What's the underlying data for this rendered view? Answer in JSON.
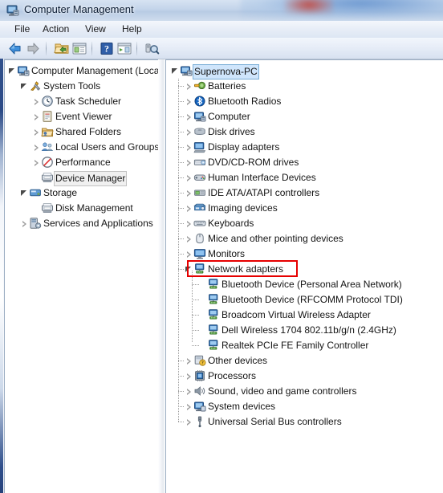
{
  "window": {
    "title": "Computer Management",
    "icon": "computer-management-icon"
  },
  "menubar": {
    "items": [
      {
        "label": "File",
        "name": "menu-file"
      },
      {
        "label": "Action",
        "name": "menu-action"
      },
      {
        "label": "View",
        "name": "menu-view"
      },
      {
        "label": "Help",
        "name": "menu-help"
      }
    ]
  },
  "toolbar": {
    "buttons": [
      {
        "name": "back-arrow-icon",
        "tip": "Back"
      },
      {
        "name": "forward-arrow-icon",
        "tip": "Forward"
      },
      {
        "name": "up-folder-icon",
        "tip": "Up One Level"
      },
      {
        "name": "show-hide-console-tree-icon",
        "tip": "Show/Hide Console Tree"
      },
      {
        "name": "help-question-icon",
        "tip": "Help"
      },
      {
        "name": "show-hide-action-pane-icon",
        "tip": "Show/Hide Action Pane"
      },
      {
        "name": "scan-hardware-changes-icon",
        "tip": "Scan for hardware changes"
      }
    ]
  },
  "left_tree": {
    "nodes": [
      {
        "label": "Computer Management (Local",
        "icon": "computer-icon",
        "indent": 0,
        "expander": "expanded",
        "state": "normal",
        "name": "tree-node-computer-management"
      },
      {
        "label": "System Tools",
        "icon": "tools-icon",
        "indent": 1,
        "expander": "expanded",
        "state": "normal",
        "name": "tree-node-system-tools"
      },
      {
        "label": "Task Scheduler",
        "icon": "clock-icon",
        "indent": 2,
        "expander": "collapsed",
        "state": "normal",
        "name": "tree-node-task-scheduler"
      },
      {
        "label": "Event Viewer",
        "icon": "event-viewer-icon",
        "indent": 2,
        "expander": "collapsed",
        "state": "normal",
        "name": "tree-node-event-viewer"
      },
      {
        "label": "Shared Folders",
        "icon": "shared-folder-icon",
        "indent": 2,
        "expander": "collapsed",
        "state": "normal",
        "name": "tree-node-shared-folders"
      },
      {
        "label": "Local Users and Groups",
        "icon": "users-group-icon",
        "indent": 2,
        "expander": "collapsed",
        "state": "normal",
        "name": "tree-node-local-users-and-groups"
      },
      {
        "label": "Performance",
        "icon": "performance-icon",
        "indent": 2,
        "expander": "collapsed",
        "state": "normal",
        "name": "tree-node-performance"
      },
      {
        "label": "Device Manager",
        "icon": "device-manager-icon",
        "indent": 2,
        "expander": "none",
        "state": "selected-inactive",
        "name": "tree-node-device-manager"
      },
      {
        "label": "Storage",
        "icon": "storage-icon",
        "indent": 1,
        "expander": "expanded",
        "state": "normal",
        "name": "tree-node-storage"
      },
      {
        "label": "Disk Management",
        "icon": "disk-management-icon",
        "indent": 2,
        "expander": "none",
        "state": "normal",
        "name": "tree-node-disk-management"
      },
      {
        "label": "Services and Applications",
        "icon": "services-icon",
        "indent": 1,
        "expander": "collapsed",
        "state": "normal",
        "name": "tree-node-services-and-applications"
      }
    ]
  },
  "right_tree": {
    "nodes": [
      {
        "label": "Supernova-PC",
        "icon": "computer-icon",
        "indent": 0,
        "expander": "expanded",
        "state": "selected-active",
        "name": "device-node-supernova-pc"
      },
      {
        "label": "Batteries",
        "icon": "battery-icon",
        "indent": 1,
        "expander": "collapsed",
        "state": "normal",
        "name": "device-node-batteries"
      },
      {
        "label": "Bluetooth Radios",
        "icon": "bluetooth-icon",
        "indent": 1,
        "expander": "collapsed",
        "state": "normal",
        "name": "device-node-bluetooth-radios"
      },
      {
        "label": "Computer",
        "icon": "computer-small-icon",
        "indent": 1,
        "expander": "collapsed",
        "state": "normal",
        "name": "device-node-computer"
      },
      {
        "label": "Disk drives",
        "icon": "disk-drive-icon",
        "indent": 1,
        "expander": "collapsed",
        "state": "normal",
        "name": "device-node-disk-drives"
      },
      {
        "label": "Display adapters",
        "icon": "display-adapter-icon",
        "indent": 1,
        "expander": "collapsed",
        "state": "normal",
        "name": "device-node-display-adapters"
      },
      {
        "label": "DVD/CD-ROM drives",
        "icon": "dvd-drive-icon",
        "indent": 1,
        "expander": "collapsed",
        "state": "normal",
        "name": "device-node-dvd-cdrom-drives"
      },
      {
        "label": "Human Interface Devices",
        "icon": "hid-icon",
        "indent": 1,
        "expander": "collapsed",
        "state": "normal",
        "name": "device-node-human-interface-devices"
      },
      {
        "label": "IDE ATA/ATAPI controllers",
        "icon": "ide-controller-icon",
        "indent": 1,
        "expander": "collapsed",
        "state": "normal",
        "name": "device-node-ide-ata-atapi-controllers"
      },
      {
        "label": "Imaging devices",
        "icon": "imaging-device-icon",
        "indent": 1,
        "expander": "collapsed",
        "state": "normal",
        "name": "device-node-imaging-devices"
      },
      {
        "label": "Keyboards",
        "icon": "keyboard-icon",
        "indent": 1,
        "expander": "collapsed",
        "state": "normal",
        "name": "device-node-keyboards"
      },
      {
        "label": "Mice and other pointing devices",
        "icon": "mouse-icon",
        "indent": 1,
        "expander": "collapsed",
        "state": "normal",
        "name": "device-node-mice-and-other-pointing-devices"
      },
      {
        "label": "Monitors",
        "icon": "monitor-icon",
        "indent": 1,
        "expander": "collapsed",
        "state": "normal",
        "name": "device-node-monitors"
      },
      {
        "label": "Network adapters",
        "icon": "network-adapter-icon",
        "indent": 1,
        "expander": "expanded",
        "state": "normal",
        "name": "device-node-network-adapters",
        "annotated": true
      },
      {
        "label": "Bluetooth Device (Personal Area Network)",
        "icon": "network-adapter-icon",
        "indent": 2,
        "expander": "none",
        "state": "normal",
        "name": "device-node-bluetooth-pan"
      },
      {
        "label": "Bluetooth Device (RFCOMM Protocol TDI)",
        "icon": "network-adapter-icon",
        "indent": 2,
        "expander": "none",
        "state": "normal",
        "name": "device-node-bluetooth-rfcomm"
      },
      {
        "label": "Broadcom Virtual Wireless Adapter",
        "icon": "network-adapter-icon",
        "indent": 2,
        "expander": "none",
        "state": "normal",
        "name": "device-node-broadcom-virtual-wireless"
      },
      {
        "label": "Dell Wireless 1704 802.11b/g/n (2.4GHz)",
        "icon": "network-adapter-icon",
        "indent": 2,
        "expander": "none",
        "state": "normal",
        "name": "device-node-dell-wireless-1704"
      },
      {
        "label": "Realtek PCIe FE Family Controller",
        "icon": "network-adapter-icon",
        "indent": 2,
        "expander": "none",
        "state": "normal",
        "name": "device-node-realtek-pcie-fe"
      },
      {
        "label": "Other devices",
        "icon": "other-device-icon",
        "indent": 1,
        "expander": "collapsed",
        "state": "normal",
        "name": "device-node-other-devices"
      },
      {
        "label": "Processors",
        "icon": "processor-icon",
        "indent": 1,
        "expander": "collapsed",
        "state": "normal",
        "name": "device-node-processors"
      },
      {
        "label": "Sound, video and game controllers",
        "icon": "sound-icon",
        "indent": 1,
        "expander": "collapsed",
        "state": "normal",
        "name": "device-node-sound-video-game-controllers"
      },
      {
        "label": "System devices",
        "icon": "system-device-icon",
        "indent": 1,
        "expander": "collapsed",
        "state": "normal",
        "name": "device-node-system-devices"
      },
      {
        "label": "Universal Serial Bus controllers",
        "icon": "usb-icon",
        "indent": 1,
        "expander": "collapsed",
        "state": "normal",
        "name": "device-node-usb-controllers"
      }
    ]
  },
  "annotation": {
    "color": "#e60000",
    "target": "Network adapters"
  },
  "colors": {
    "titlebar_blue": "#b8cbe4",
    "selection_active": "#cfe5fb",
    "selection_inactive": "#f0f0f0",
    "annotation_red": "#e60000"
  }
}
